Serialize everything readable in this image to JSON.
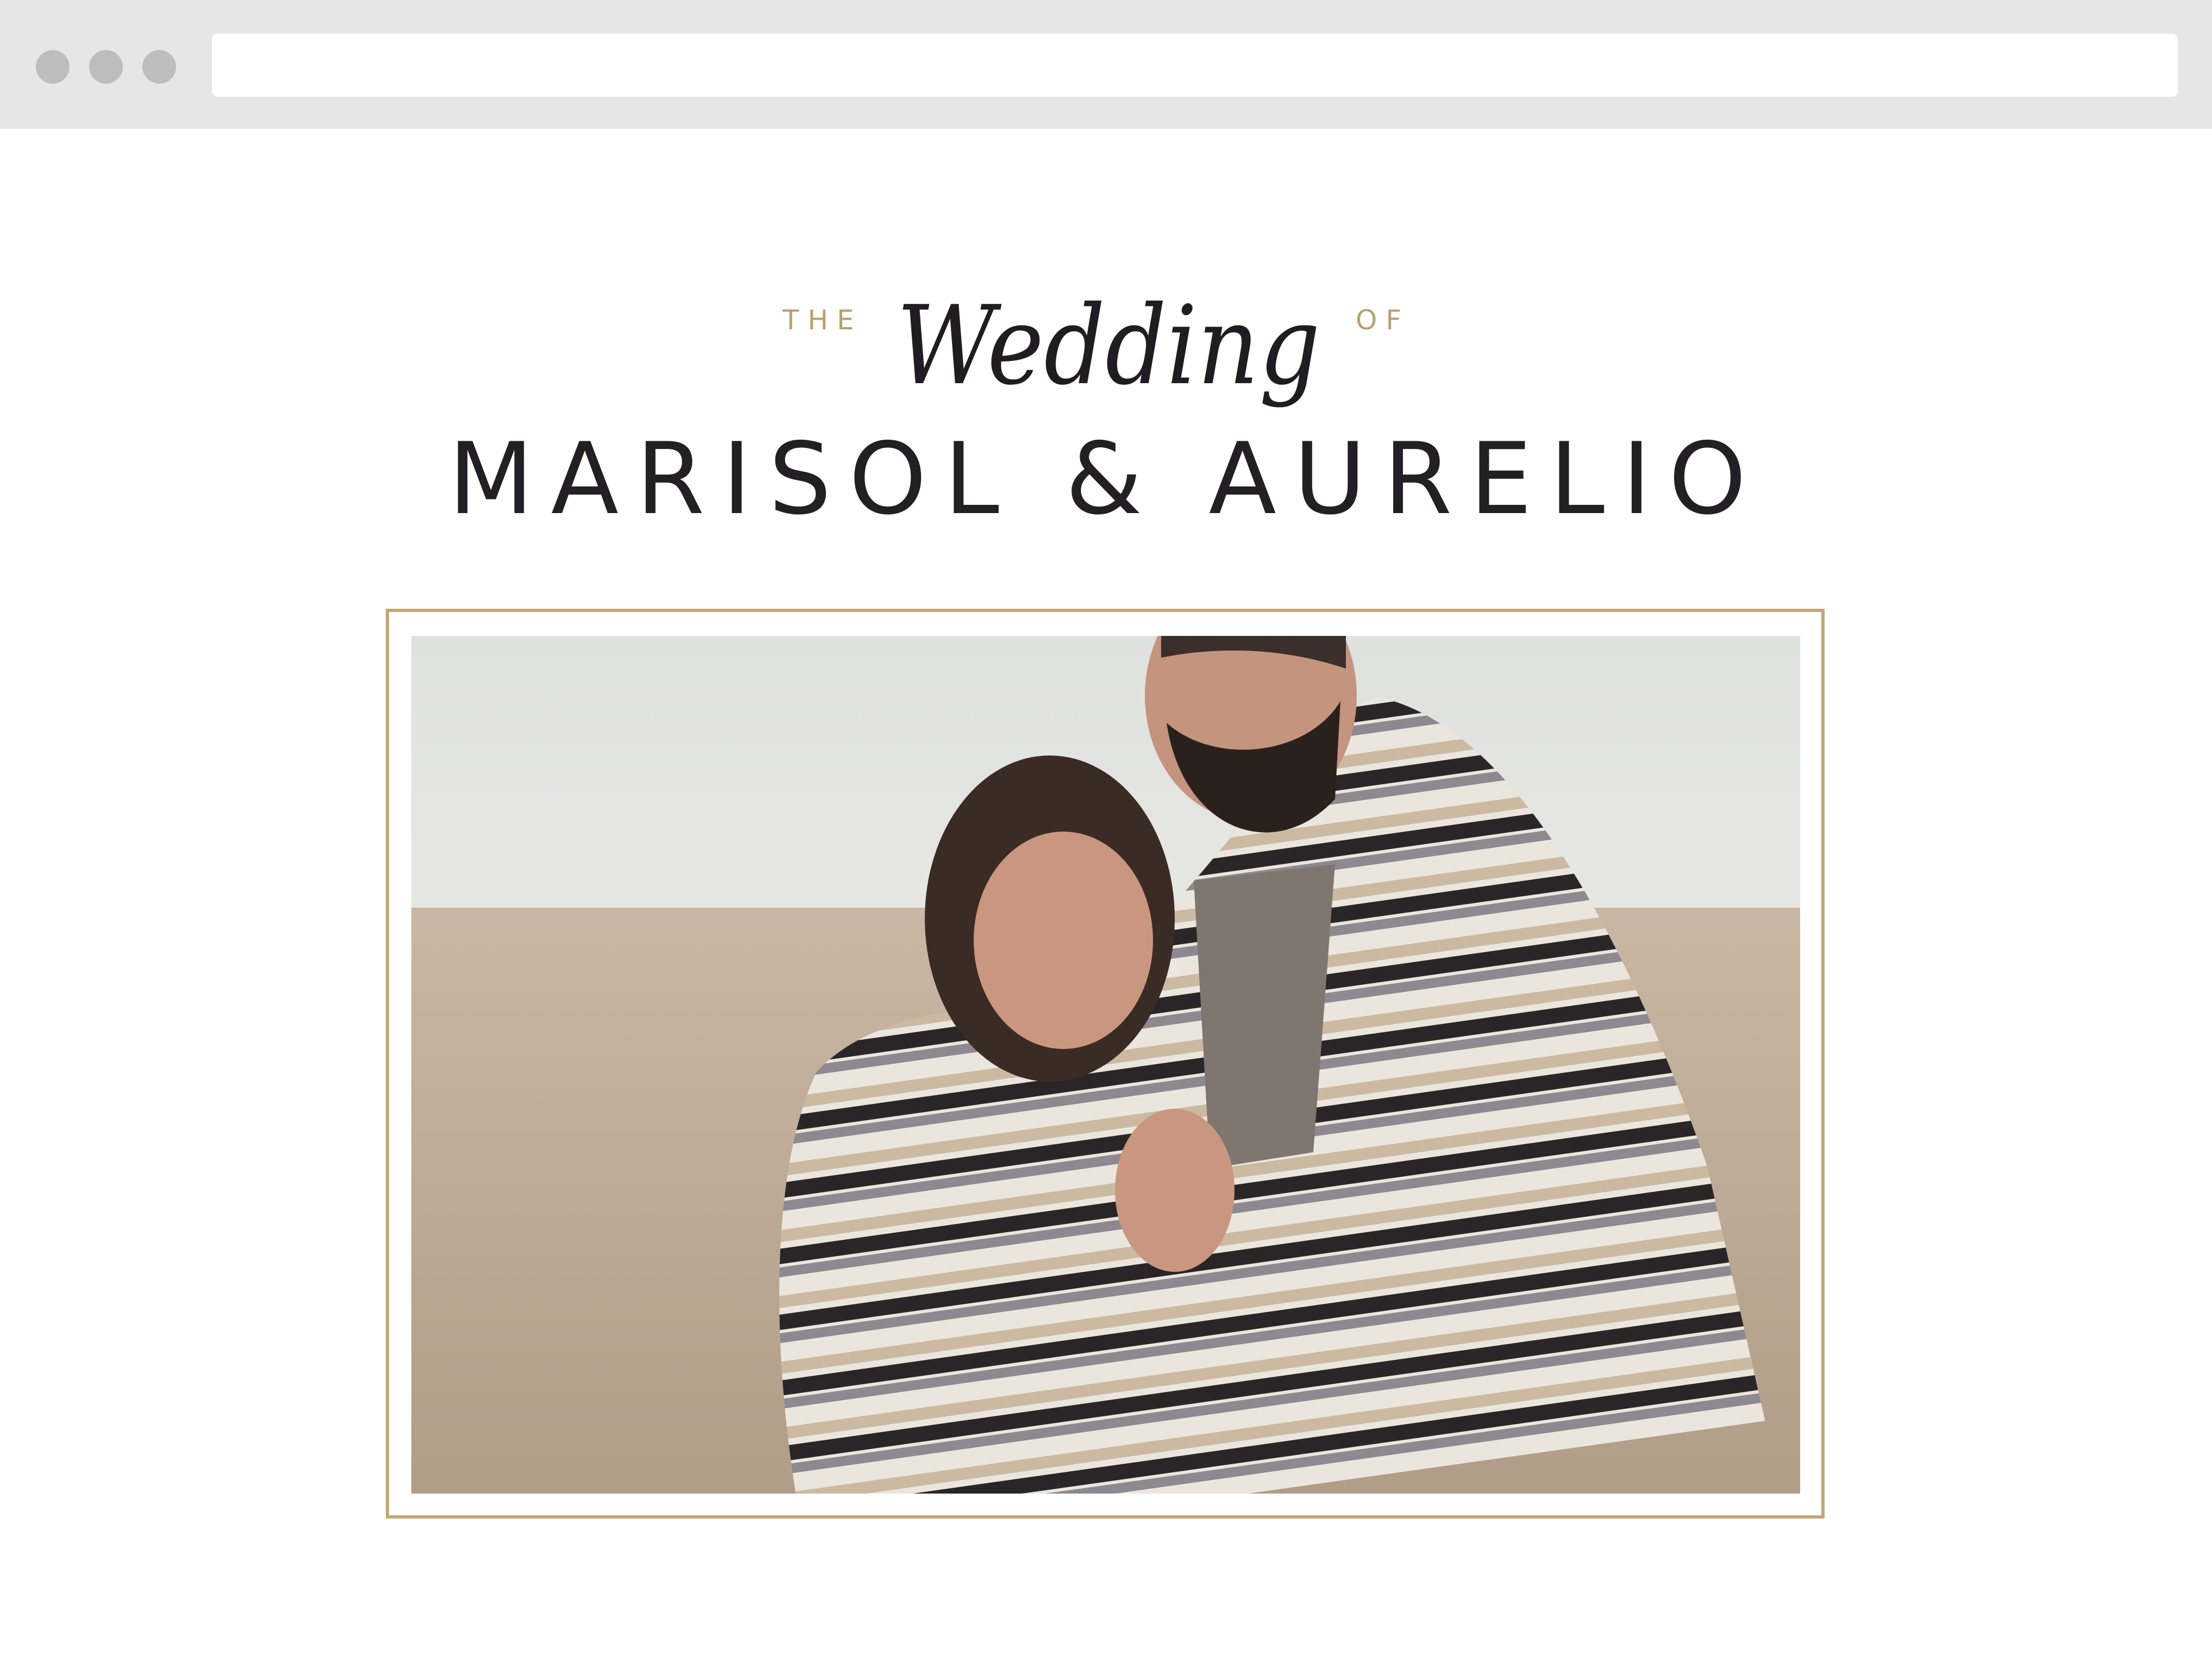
{
  "browser": {
    "window_buttons": [
      "dot",
      "dot",
      "dot"
    ],
    "address": ""
  },
  "header": {
    "kicker_left": "THE",
    "script_word": "Wedding",
    "kicker_right": "OF",
    "couple_names": "MARISOL & AURELIO"
  },
  "colors": {
    "accent_gold": "#b9a06e",
    "text_dark": "#222024",
    "chrome_gray": "#e6e6e6"
  }
}
